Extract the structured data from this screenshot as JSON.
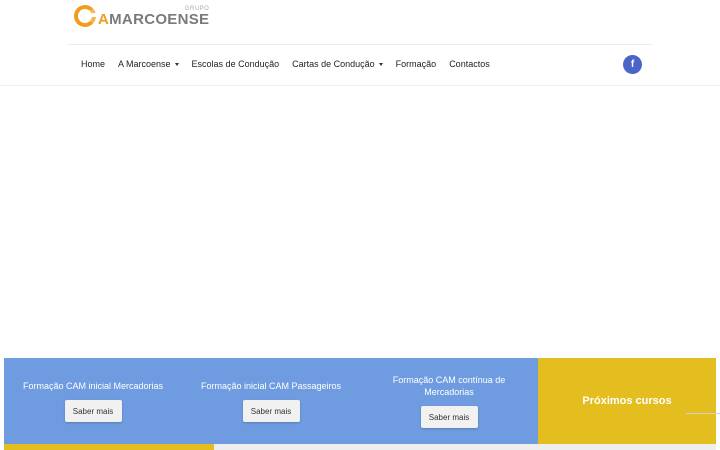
{
  "logo": {
    "small": "GRUPO",
    "first_letter": "A",
    "rest": "MARCOENSE"
  },
  "nav": {
    "items": [
      {
        "label": "Home",
        "dropdown": false
      },
      {
        "label": "A Marcoense",
        "dropdown": true
      },
      {
        "label": "Escolas de Condução",
        "dropdown": false
      },
      {
        "label": "Cartas de Condução",
        "dropdown": true
      },
      {
        "label": "Formação",
        "dropdown": false
      },
      {
        "label": "Contactos",
        "dropdown": false
      }
    ],
    "social_icon": "f"
  },
  "courses": [
    {
      "title": "Formação CAM inicial Mercadorias",
      "button": "Saber mais"
    },
    {
      "title": "Formação inicial CAM Passageiros",
      "button": "Saber mais"
    },
    {
      "title": "Formação CAM contínua de Mercadorias",
      "button": "Saber mais"
    }
  ],
  "next_courses": "Próximos cursos",
  "colors": {
    "accent_blue": "#6f9ce0",
    "accent_yellow": "#e4bd1f",
    "logo_orange": "#f29c1f",
    "facebook": "#4b64c8"
  },
  "icons": {
    "social": "facebook-icon",
    "dropdown": "caret-down-icon"
  }
}
